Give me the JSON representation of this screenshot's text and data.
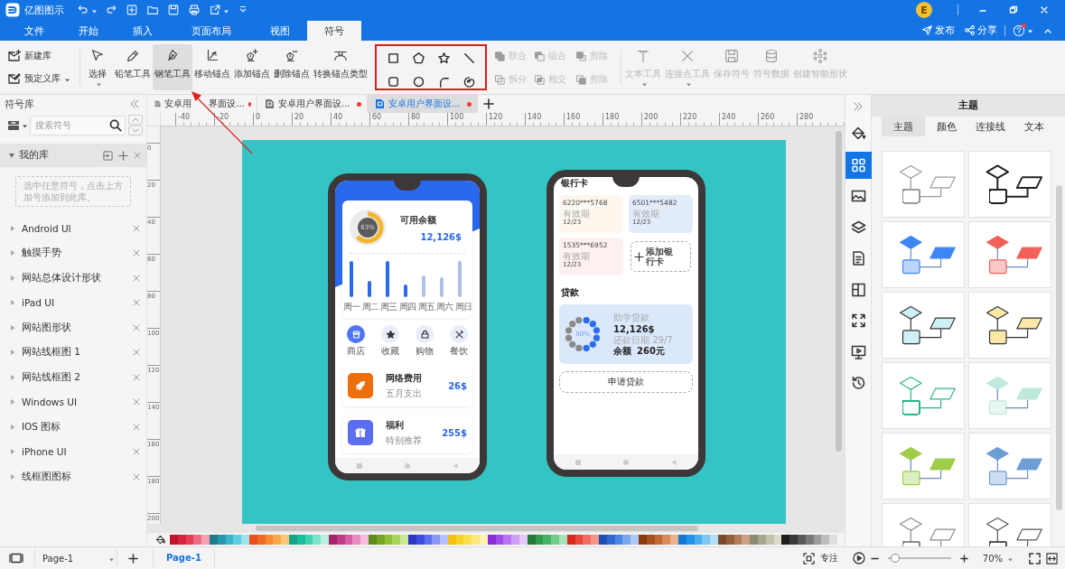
{
  "app": {
    "title": "亿图图示",
    "avatar": "E"
  },
  "menu_tabs": [
    {
      "label": "文件",
      "selected": false
    },
    {
      "label": "开始",
      "selected": false
    },
    {
      "label": "插入",
      "selected": false
    },
    {
      "label": "页面布局",
      "selected": false
    },
    {
      "label": "视图",
      "selected": false
    },
    {
      "label": "符号",
      "selected": true
    }
  ],
  "header_actions": [
    {
      "kind": "publish",
      "label": "发布"
    },
    {
      "kind": "share",
      "label": "分享"
    }
  ],
  "ribbon": {
    "library_buttons": [
      {
        "kind": "new",
        "label": "新建库",
        "dropdown": false
      },
      {
        "kind": "predefined",
        "label": "预定义库",
        "dropdown": true
      }
    ],
    "tools": [
      {
        "kind": "select",
        "label": "选择",
        "selected": false,
        "dropdown": true
      },
      {
        "kind": "pencil",
        "label": "铅笔工具",
        "selected": false,
        "dropdown": false
      },
      {
        "kind": "pen",
        "label": "钢笔工具",
        "selected": true,
        "dropdown": false
      },
      {
        "kind": "move-anchor",
        "label": "移动锚点",
        "selected": false,
        "dropdown": false
      },
      {
        "kind": "add-anchor",
        "label": "添加锚点",
        "selected": false,
        "dropdown": false
      },
      {
        "kind": "delete-anchor",
        "label": "删除锚点",
        "selected": false,
        "dropdown": false
      },
      {
        "kind": "convert-anchor",
        "label": "转换锚点类型",
        "selected": false,
        "dropdown": false
      }
    ],
    "shapes": [
      {
        "kind": "square"
      },
      {
        "kind": "pentagon"
      },
      {
        "kind": "star"
      },
      {
        "kind": "line"
      },
      {
        "kind": "rounded-square"
      },
      {
        "kind": "circle"
      },
      {
        "kind": "arc"
      },
      {
        "kind": "spiral"
      }
    ],
    "shape_ops": [
      {
        "kind": "union",
        "label": "联合",
        "disabled": true
      },
      {
        "kind": "group",
        "label": "组合",
        "disabled": true
      },
      {
        "kind": "subtract",
        "label": "剪除",
        "disabled": true
      },
      {
        "kind": "split",
        "label": "拆分",
        "disabled": true
      },
      {
        "kind": "intersect",
        "label": "相交",
        "disabled": true
      },
      {
        "kind": "subtract-front",
        "label": "剪除",
        "disabled": true
      }
    ],
    "symbol_tools": [
      {
        "kind": "text",
        "label": "文本工具",
        "disabled": true,
        "dropdown": true
      },
      {
        "kind": "connector",
        "label": "连接点工具",
        "disabled": true,
        "dropdown": true
      },
      {
        "kind": "save",
        "label": "保存符号",
        "disabled": true,
        "dropdown": false
      },
      {
        "kind": "data",
        "label": "符号数据",
        "disabled": true,
        "dropdown": false
      },
      {
        "kind": "smart",
        "label": "创建智能形状",
        "disabled": true,
        "dropdown": false
      }
    ]
  },
  "symbol_library": {
    "title": "符号库",
    "search": {
      "placeholder": "搜索符号"
    },
    "my_library": {
      "label": "我的库",
      "expanded": true,
      "hint": "选中任意符号，点击上方加号添加到此库。"
    },
    "libraries": [
      {
        "label": "Android UI",
        "expanded": false
      },
      {
        "label": "触摸手势",
        "expanded": false
      },
      {
        "label": "网站总体设计形状",
        "expanded": false
      },
      {
        "label": "iPad UI",
        "expanded": false
      },
      {
        "label": "网站图形状",
        "expanded": false
      },
      {
        "label": "网站线框图 1",
        "expanded": false
      },
      {
        "label": "网站线框图 2",
        "expanded": false
      },
      {
        "label": "Windows UI",
        "expanded": false
      },
      {
        "label": "IOS 图标",
        "expanded": false
      },
      {
        "label": "iPhone UI",
        "expanded": false
      },
      {
        "label": "线框图图标",
        "expanded": false
      }
    ]
  },
  "document_tabs": [
    {
      "label": "安卓用 界面设...",
      "selected": false,
      "modified": true
    },
    {
      "label": "安卓用户界面设...",
      "selected": false,
      "modified": true
    },
    {
      "label": "安卓用户界面设...",
      "selected": true,
      "modified": true
    }
  ],
  "rulers": {
    "horizontal": [
      "-40",
      "-20",
      "0",
      "20",
      "40",
      "60",
      "80",
      "100",
      "120",
      "140",
      "160",
      "180",
      "200",
      "220",
      "240",
      "260",
      "280"
    ],
    "vertical": [
      "0",
      "20",
      "40",
      "60",
      "80",
      "100",
      "120",
      "140",
      "160",
      "180",
      "200"
    ]
  },
  "phones": [
    {
      "kind": "wallet",
      "balance_label": "可用余额",
      "balance": "12,126$",
      "progress": {
        "level": 0.63,
        "label": "63%"
      },
      "days": [
        "周一",
        "周二",
        "周三",
        "周四",
        "周五",
        "周六",
        "周日"
      ],
      "categories": [
        {
          "kind": "shop",
          "label": "商店",
          "selected": true
        },
        {
          "kind": "star",
          "label": "收藏",
          "selected": false
        },
        {
          "kind": "bag",
          "label": "购物",
          "selected": false
        },
        {
          "kind": "food",
          "label": "餐饮",
          "selected": false
        }
      ],
      "transactions": [
        {
          "kind": "rocket",
          "title": "网络费用",
          "subtitle": "五月支出",
          "amount": "26$",
          "color": "#ee6d0c"
        },
        {
          "kind": "gift",
          "title": "福利",
          "subtitle": "特别推荐",
          "amount": "255$",
          "color": "#5b6ef2"
        }
      ]
    },
    {
      "kind": "bank",
      "cards_title": "银行卡",
      "cards": [
        {
          "number": "6220***5768",
          "expiry_label": "有效期",
          "expiry": "12/23",
          "color": "#fdf7ee"
        },
        {
          "number": "6501***5482",
          "expiry_label": "有效期",
          "expiry": "12/23",
          "color": "#e2ecfb"
        },
        {
          "number": "1535***6952",
          "expiry_label": "有效期",
          "expiry": "12/23",
          "color": "#fcf0f1"
        }
      ],
      "add_card": "添加银行卡",
      "loans_title": "贷款",
      "loan": {
        "title": "助学贷款",
        "amount": "12,126$",
        "due": "还款日期 29/7",
        "balance_label": "余额",
        "balance": "260元",
        "progress": {
          "level": 0.5,
          "label": "50%"
        }
      },
      "apply_button": "申请贷款"
    }
  ],
  "annotations": {
    "highlight_shapes": true,
    "arrow": true
  },
  "palette": [
    {
      "color": "#c0142e"
    },
    {
      "color": "#d9223c"
    },
    {
      "color": "#e63e58"
    },
    {
      "color": "#ef6b82"
    },
    {
      "color": "#f4a0b0"
    },
    {
      "color": "#1f7d8c"
    },
    {
      "color": "#2897ac"
    },
    {
      "color": "#3bb3ca"
    },
    {
      "color": "#5fcde0"
    },
    {
      "color": "#9fe2ee"
    },
    {
      "color": "#e94e1b"
    },
    {
      "color": "#f06a24"
    },
    {
      "color": "#f58b32"
    },
    {
      "color": "#f9a94b"
    },
    {
      "color": "#fbc77a"
    },
    {
      "color": "#12a58a"
    },
    {
      "color": "#1cbf9c"
    },
    {
      "color": "#3fd3b0"
    },
    {
      "color": "#7fe3cb"
    },
    {
      "color": "#b9f0e2"
    },
    {
      "color": "#a3246b"
    },
    {
      "color": "#c13b87"
    },
    {
      "color": "#d75ea3"
    },
    {
      "color": "#e88cc0"
    },
    {
      "color": "#f3bcdc"
    },
    {
      "color": "#5b8c1c"
    },
    {
      "color": "#74a624"
    },
    {
      "color": "#8fc035"
    },
    {
      "color": "#acd45c"
    },
    {
      "color": "#cce694"
    },
    {
      "color": "#2b36c4"
    },
    {
      "color": "#3c4de0"
    },
    {
      "color": "#5d6ef0"
    },
    {
      "color": "#8a97f5"
    },
    {
      "color": "#b7c0fa"
    },
    {
      "color": "#f3c10e"
    },
    {
      "color": "#f7d326"
    },
    {
      "color": "#fae04f"
    },
    {
      "color": "#fbe97e"
    },
    {
      "color": "#fdf2b0"
    },
    {
      "color": "#8a2bd8"
    },
    {
      "color": "#a34bea"
    },
    {
      "color": "#b974f2"
    },
    {
      "color": "#cf9ff7"
    },
    {
      "color": "#e4c8fb"
    },
    {
      "color": "#237a3b"
    },
    {
      "color": "#2f9a4c"
    },
    {
      "color": "#44b363"
    },
    {
      "color": "#74cc8c"
    },
    {
      "color": "#a9e2b8"
    },
    {
      "color": "#d72a1f"
    },
    {
      "color": "#e8483a"
    },
    {
      "color": "#f16d5f"
    },
    {
      "color": "#f79589"
    },
    {
      "color": "#1f4fb3"
    },
    {
      "color": "#2e68d0"
    },
    {
      "color": "#4c86e3"
    },
    {
      "color": "#7ba7ee"
    },
    {
      "color": "#adc9f6"
    },
    {
      "color": "#8c3a12"
    },
    {
      "color": "#a8501f"
    },
    {
      "color": "#c26a33"
    },
    {
      "color": "#d78c57"
    },
    {
      "color": "#e8b38c"
    },
    {
      "color": "#1477d4"
    },
    {
      "color": "#2294ea"
    },
    {
      "color": "#49aef2"
    },
    {
      "color": "#7cc7f6"
    },
    {
      "color": "#b3def9"
    },
    {
      "color": "#7a4a2e"
    },
    {
      "color": "#96603d"
    },
    {
      "color": "#b27e5a"
    },
    {
      "color": "#cba184"
    },
    {
      "color": "#8a8a6e"
    },
    {
      "color": "#a7a78c"
    },
    {
      "color": "#c4c4ad"
    },
    {
      "color": "#dcdccb"
    },
    {
      "color": "#1e1e1e"
    },
    {
      "color": "#3a3a3a"
    },
    {
      "color": "#595959"
    },
    {
      "color": "#7a7a7a"
    },
    {
      "color": "#9c9c9c"
    },
    {
      "color": "#bdbdbd"
    },
    {
      "color": "#dedede"
    }
  ],
  "side_strip": [
    {
      "kind": "fill",
      "selected": false
    },
    {
      "kind": "theme",
      "selected": true
    },
    {
      "kind": "image",
      "selected": false
    },
    {
      "kind": "layers",
      "selected": false
    },
    {
      "kind": "document",
      "selected": false
    },
    {
      "kind": "page",
      "selected": false
    },
    {
      "kind": "fit",
      "selected": false
    },
    {
      "kind": "present",
      "selected": false
    },
    {
      "kind": "history",
      "selected": false
    }
  ],
  "theme_panel": {
    "title": "主题",
    "tabs": [
      {
        "label": "主题",
        "selected": true
      },
      {
        "label": "颜色",
        "selected": false
      },
      {
        "label": "连接线",
        "selected": false
      },
      {
        "label": "文本",
        "selected": false
      }
    ],
    "themes": [
      {
        "kind": "outline",
        "color": "#9a9a9a"
      },
      {
        "kind": "outline",
        "color": "#222222"
      },
      {
        "kind": "filled",
        "color": "#3d87f5"
      },
      {
        "kind": "filled",
        "color": "#f2605a"
      },
      {
        "kind": "pastel",
        "color": "#cdeff6"
      },
      {
        "kind": "pastel",
        "color": "#fbe8a6"
      },
      {
        "kind": "outline",
        "color": "#2bb38a"
      },
      {
        "kind": "filled",
        "color": "#bfe9dc"
      },
      {
        "kind": "filled",
        "color": "#9fcd4a"
      },
      {
        "kind": "filled",
        "color": "#6d9fd6"
      },
      {
        "kind": "outline",
        "color": "#8a8a8a"
      },
      {
        "kind": "outline",
        "color": "#555555"
      }
    ]
  },
  "status_bar": {
    "page_select": "Page-1",
    "pages": [
      {
        "label": "Page-1",
        "selected": true
      }
    ],
    "focus": "专注",
    "zoom": {
      "level": 0.12,
      "label": "70%"
    }
  }
}
